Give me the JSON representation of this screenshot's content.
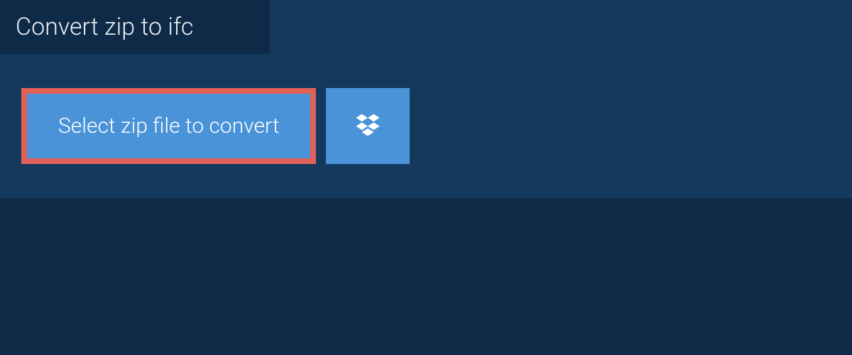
{
  "tab": {
    "title": "Convert zip to ifc"
  },
  "actions": {
    "select_label": "Select zip file to convert"
  },
  "colors": {
    "page_bg": "#0e2a47",
    "panel_bg": "#14395c",
    "button_bg": "#4a93d9",
    "button_border": "#e16058",
    "text_light": "#ffffff"
  }
}
